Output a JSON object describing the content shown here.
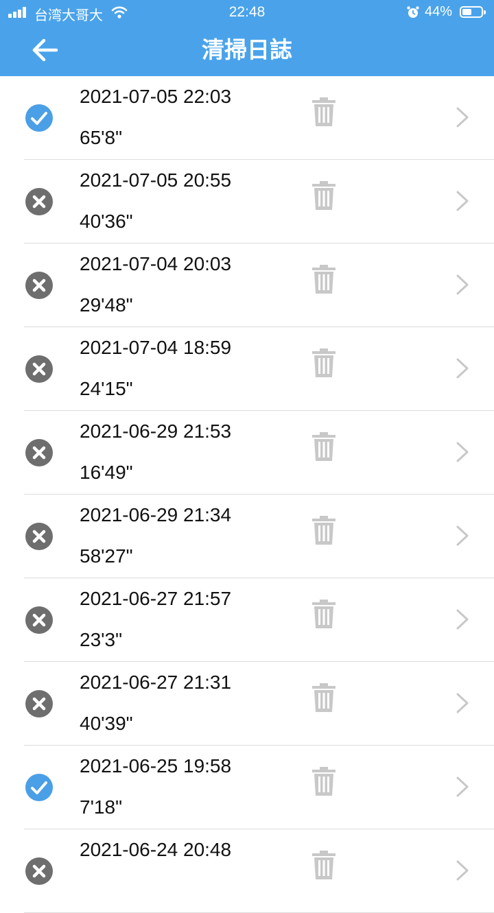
{
  "status_bar": {
    "carrier": "台湾大哥大",
    "time": "22:48",
    "battery": "44%",
    "icons": [
      "signal-icon",
      "wifi-icon",
      "alarm-icon",
      "battery-icon"
    ]
  },
  "header": {
    "title": "清掃日誌",
    "back_icon": "arrow-left-icon",
    "background": "#4aa3ea"
  },
  "colors": {
    "success": "#4a9fe6",
    "failed": "#6e6e6e",
    "trash": "#c8c8c8",
    "chevron": "#c8c8c8"
  },
  "logs": [
    {
      "datetime": "2021-07-05 22:03",
      "duration": "65'8\"",
      "status": "success"
    },
    {
      "datetime": "2021-07-05 20:55",
      "duration": "40'36\"",
      "status": "failed"
    },
    {
      "datetime": "2021-07-04 20:03",
      "duration": "29'48\"",
      "status": "failed"
    },
    {
      "datetime": "2021-07-04 18:59",
      "duration": "24'15\"",
      "status": "failed"
    },
    {
      "datetime": "2021-06-29 21:53",
      "duration": "16'49\"",
      "status": "failed"
    },
    {
      "datetime": "2021-06-29 21:34",
      "duration": "58'27\"",
      "status": "failed"
    },
    {
      "datetime": "2021-06-27 21:57",
      "duration": "23'3\"",
      "status": "failed"
    },
    {
      "datetime": "2021-06-27 21:31",
      "duration": "40'39\"",
      "status": "failed"
    },
    {
      "datetime": "2021-06-25 19:58",
      "duration": "7'18\"",
      "status": "success"
    },
    {
      "datetime": "2021-06-24 20:48",
      "duration": "",
      "status": "failed"
    }
  ]
}
